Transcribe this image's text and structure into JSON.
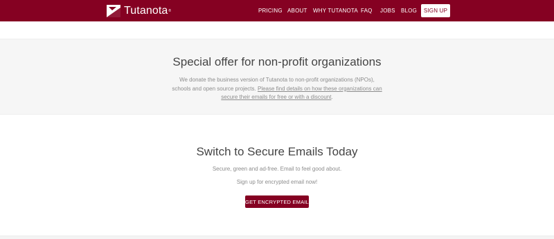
{
  "brand": {
    "name": "Tutanota",
    "reg": "®",
    "color": "#850122"
  },
  "nav": {
    "items": [
      {
        "label": "PRICING"
      },
      {
        "label": "ABOUT"
      },
      {
        "label": "WHY TUTANOTA"
      },
      {
        "label": "FAQ"
      },
      {
        "label": "JOBS"
      },
      {
        "label": "BLOG"
      }
    ],
    "signup_label": "SIGN UP"
  },
  "offer": {
    "title": "Special offer for non-profit organizations",
    "text": "We donate the business version of Tutanota to non-profit organizations (NPOs), schools and open source projects. ",
    "link_text": "Please find details on how these organizations can secure their emails for free or with a discount",
    "trailing": "."
  },
  "cta": {
    "title": "Switch to Secure Emails Today",
    "line1": "Secure, green and ad-free. Email to feel good about.",
    "line2": "Sign up for encrypted email now!",
    "button_label": "GET ENCRYPTED EMAIL"
  }
}
